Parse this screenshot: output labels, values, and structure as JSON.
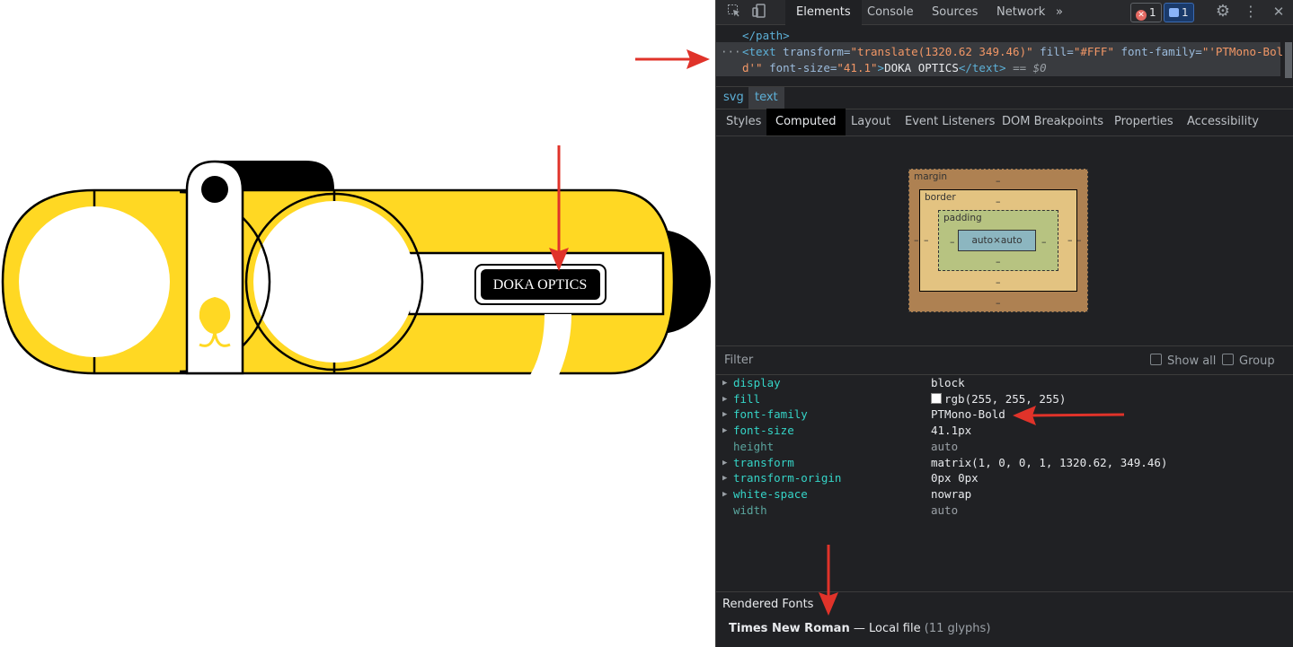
{
  "illustration": {
    "label_text": "DOKA OPTICS",
    "body_color": "#FFD823",
    "outline_color": "#000000"
  },
  "devtools": {
    "toolbar": {
      "tabs": [
        "Elements",
        "Console",
        "Sources",
        "Network"
      ],
      "more": "»",
      "error_count": "1",
      "message_count": "1",
      "icons": [
        "inspect-icon",
        "device-toggle-icon",
        "settings-icon",
        "more-vert-icon",
        "close-icon"
      ]
    },
    "code": {
      "line1_tag": "</path>",
      "line2_open": "<text",
      "attr_transform": "transform=",
      "val_transform": "\"translate(1320.62 349.46)\"",
      "attr_fill": "fill=",
      "val_fill": "\"#FFF\"",
      "attr_font_family": "font-family=",
      "val_font_family_a": "\"'PTMono-Bol",
      "val_font_family_b": "d'\"",
      "attr_font_size": "font-size=",
      "val_font_size": "\"41.1\"",
      "close_gt": ">",
      "text_content": "DOKA OPTICS",
      "close_tag": "</text>",
      "eq_marker": "== $0",
      "ellipsis": "···"
    },
    "breadcrumbs": [
      "svg",
      "text"
    ],
    "subtabs": [
      "Styles",
      "Computed",
      "Layout",
      "Event Listeners",
      "DOM Breakpoints",
      "Properties",
      "Accessibility"
    ],
    "box_model": {
      "margin_label": "margin",
      "border_label": "border",
      "padding_label": "padding",
      "content": "auto×auto",
      "dash": "–"
    },
    "filter": {
      "placeholder": "Filter",
      "show_all": "Show all",
      "group": "Group"
    },
    "computed": [
      {
        "name": "display",
        "value": "block",
        "dim": false
      },
      {
        "name": "fill",
        "value": "rgb(255, 255, 255)",
        "dim": false
      },
      {
        "name": "font-family",
        "value": "PTMono-Bold",
        "dim": false
      },
      {
        "name": "font-size",
        "value": "41.1px",
        "dim": false
      },
      {
        "name": "height",
        "value": "auto",
        "dim": true
      },
      {
        "name": "transform",
        "value": "matrix(1, 0, 0, 1, 1320.62, 349.46)",
        "dim": false
      },
      {
        "name": "transform-origin",
        "value": "0px 0px",
        "dim": false
      },
      {
        "name": "white-space",
        "value": "nowrap",
        "dim": false
      },
      {
        "name": "width",
        "value": "auto",
        "dim": true
      }
    ],
    "rendered_fonts": {
      "heading": "Rendered Fonts",
      "font_name": "Times New Roman",
      "separator": "—",
      "source": "Local file",
      "glyphs": "(11 glyphs)"
    }
  },
  "annotation_color": "#E0332A"
}
